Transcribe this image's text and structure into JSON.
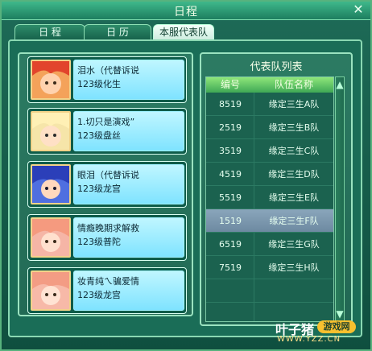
{
  "window": {
    "title": "日程",
    "close_symbol": "✕"
  },
  "tabs": [
    {
      "label": "日 程",
      "active": false
    },
    {
      "label": "日 历",
      "active": false
    },
    {
      "label": "本服代表队",
      "active": true
    }
  ],
  "members": [
    {
      "name": "泪水（代替诉说",
      "level": "123级化生",
      "avatar_icon": "red-hair-boy-avatar-icon"
    },
    {
      "name": "1.切只是演戏”",
      "level": "123级盘丝",
      "avatar_icon": "blonde-girl-avatar-icon"
    },
    {
      "name": "眼泪（代替诉说",
      "level": "123级龙宫",
      "avatar_icon": "blue-hair-girl-avatar-icon"
    },
    {
      "name": "情瘾晚期求解救",
      "level": "123级普陀",
      "avatar_icon": "pink-hair-girl-avatar-icon"
    },
    {
      "name": "妆青纯ㄟ骗爱情",
      "level": "123级龙宫",
      "avatar_icon": "pink-hair-girl-avatar-icon"
    }
  ],
  "team_list": {
    "title": "代表队列表",
    "headers": {
      "id": "编号",
      "name": "队伍名称"
    },
    "rows": [
      {
        "id": "8519",
        "name": "缘定三生A队"
      },
      {
        "id": "2519",
        "name": "缘定三生B队"
      },
      {
        "id": "3519",
        "name": "缘定三生C队"
      },
      {
        "id": "4519",
        "name": "缘定三生D队"
      },
      {
        "id": "5519",
        "name": "缘定三生E队"
      },
      {
        "id": "1519",
        "name": "缘定三生F队"
      },
      {
        "id": "6519",
        "name": "缘定三生G队"
      },
      {
        "id": "7519",
        "name": "缘定三生H队"
      }
    ],
    "selected_id": "1519"
  },
  "scroll": {
    "up_icon": "scroll-up-icon",
    "down_icon": "scroll-down-icon"
  },
  "watermark": {
    "brand": "叶子猪",
    "badge": "游戏网",
    "url": "WWW.YZZ.CN"
  },
  "colors": {
    "accent": "#58b27e",
    "selected_row": "#7f9bb0",
    "header": "#6fd86a"
  }
}
